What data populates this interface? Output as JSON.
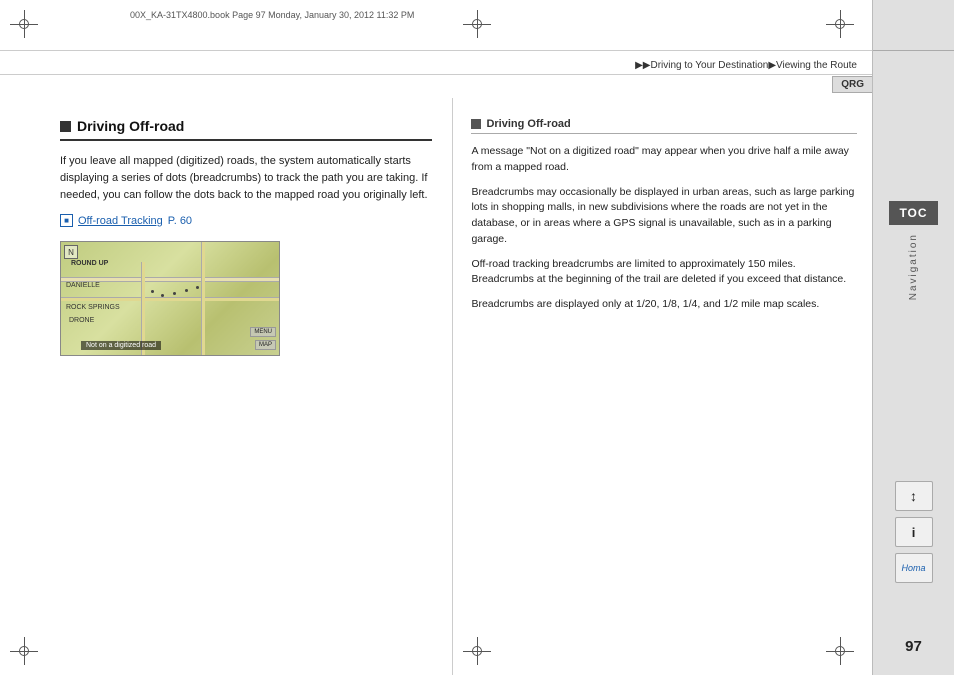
{
  "page": {
    "file_info": "00X_KA-31TX4800.book  Page 97  Monday, January 30, 2012  11:32 PM",
    "page_number": "97",
    "breadcrumb": "▶▶Driving to Your Destination▶Viewing the Route",
    "qrg_label": "QRG",
    "toc_label": "TOC",
    "nav_label": "Navigation"
  },
  "left_section": {
    "title": "Driving Off-road",
    "body": "If you leave all mapped (digitized) roads, the system automatically starts displaying a series of dots (breadcrumbs) to track the path you are taking. If needed, you can follow the dots back to the mapped road you originally left.",
    "link_text": "Off-road Tracking",
    "link_page": "P. 60"
  },
  "right_section": {
    "title": "Driving Off-road",
    "paragraphs": [
      "A message \"Not on a digitized road\" may appear when you drive half a mile away from a mapped road.",
      "Breadcrumbs may occasionally be displayed in urban areas, such as large parking lots in shopping malls, in new subdivisions where the roads are not yet in the database, or in areas where a GPS signal is unavailable, such as in a parking garage.",
      "Off-road tracking breadcrumbs are limited to approximately 150 miles. Breadcrumbs at the beginning of the trail are deleted if you exceed that distance.",
      "Breadcrumbs are displayed only at 1/20, 1/8, 1/4, and 1/2 mile map scales."
    ]
  },
  "sidebar_icons": {
    "arrows_icon": "↕",
    "info_icon": "i",
    "home_label": "Homa"
  }
}
